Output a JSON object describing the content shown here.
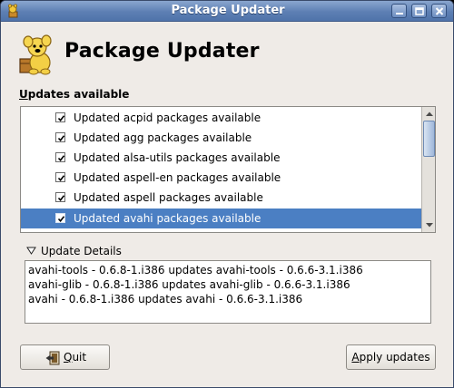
{
  "window": {
    "title": "Package Updater"
  },
  "header": {
    "title": "Package Updater",
    "icon": "package-dog-icon"
  },
  "updates": {
    "section_label_mnemonic": "U",
    "section_label_rest": "pdates available",
    "items": [
      {
        "label": "Updated acpid packages available",
        "checked": true,
        "selected": false
      },
      {
        "label": "Updated agg packages available",
        "checked": true,
        "selected": false
      },
      {
        "label": "Updated alsa-utils packages available",
        "checked": true,
        "selected": false
      },
      {
        "label": "Updated aspell-en packages available",
        "checked": true,
        "selected": false
      },
      {
        "label": "Updated aspell packages available",
        "checked": true,
        "selected": false
      },
      {
        "label": "Updated avahi packages available",
        "checked": true,
        "selected": true
      }
    ]
  },
  "details": {
    "expander_label": "Update Details",
    "lines": [
      "avahi-tools - 0.6.8-1.i386 updates avahi-tools - 0.6.6-3.1.i386",
      "avahi-glib - 0.6.8-1.i386 updates avahi-glib - 0.6.6-3.1.i386",
      "avahi - 0.6.8-1.i386 updates avahi - 0.6.6-3.1.i386"
    ]
  },
  "buttons": {
    "quit_mnemonic": "Q",
    "quit_rest": "uit",
    "apply_mnemonic": "A",
    "apply_rest": "pply updates"
  },
  "colors": {
    "selection": "#4b7fc3",
    "titlebar": "#5d7fb3",
    "window_bg": "#efebe7"
  }
}
